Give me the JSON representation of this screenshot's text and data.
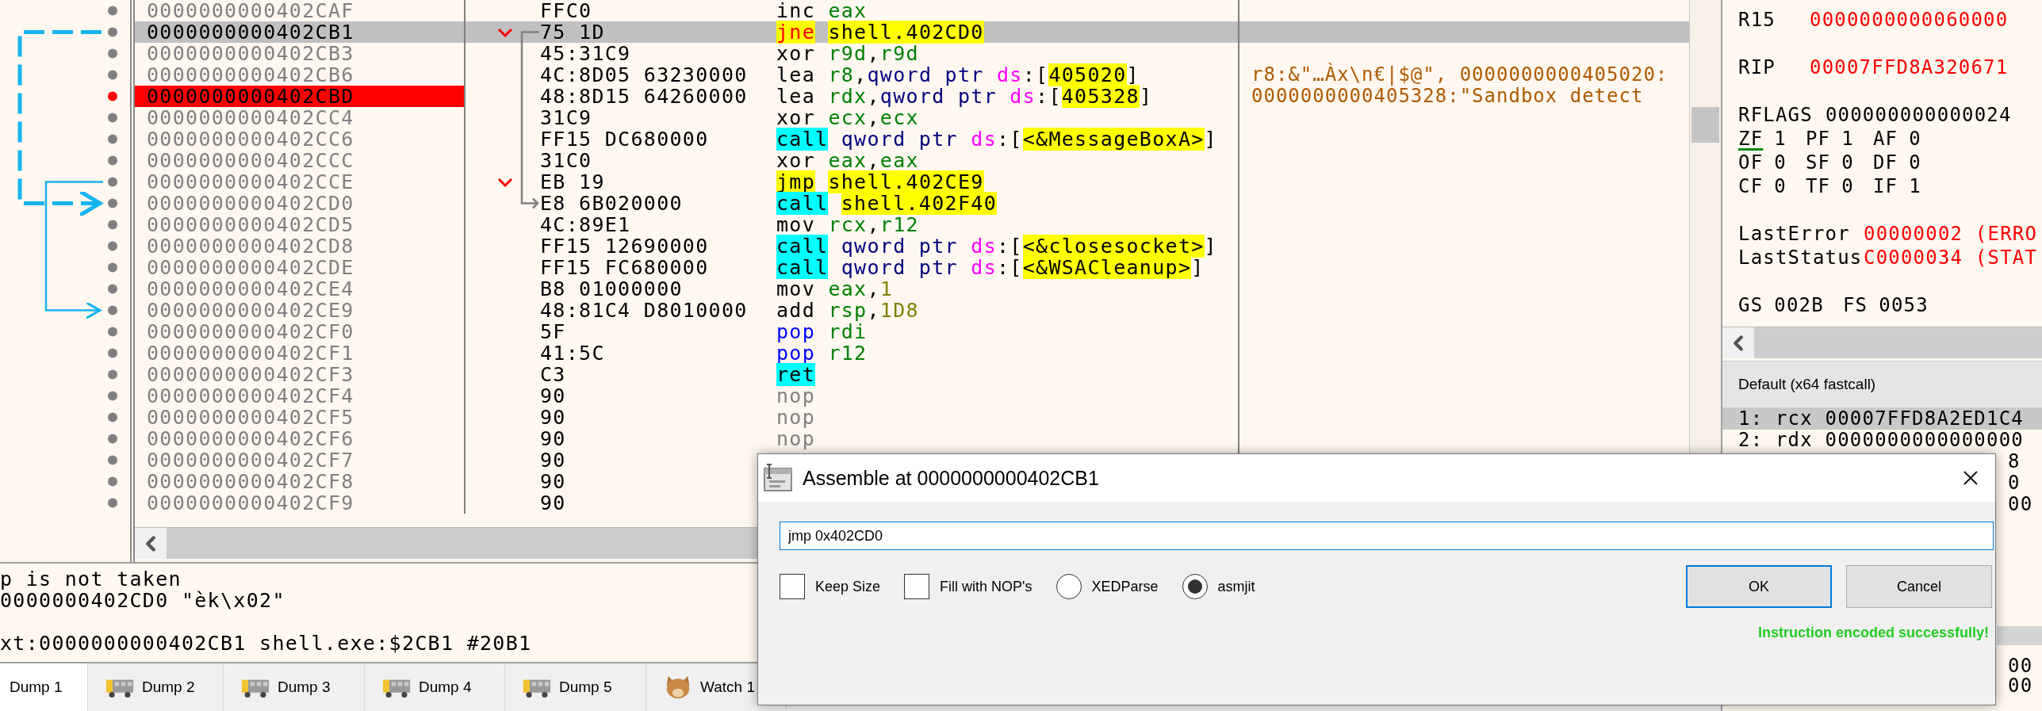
{
  "disassembly": {
    "rows": [
      {
        "address": "0000000000402CAF",
        "bytes": "FFC0",
        "instruction": [
          {
            "text": "inc",
            "kind": "mnemonic"
          },
          {
            "text": " eax",
            "kind": "reg"
          }
        ],
        "selected": false,
        "breakpoint": false,
        "branch": false
      },
      {
        "address": "0000000000402CB1",
        "bytes": "75 1D",
        "instruction": [
          {
            "text": "jne",
            "kind": "cjump"
          },
          {
            "text": " shell.402CD0",
            "kind": "sym"
          }
        ],
        "selected": true,
        "breakpoint": false,
        "branch": true
      },
      {
        "address": "0000000000402CB3",
        "bytes": "45:31C9",
        "instruction": [
          {
            "text": "xor",
            "kind": "mnemonic"
          },
          {
            "text": " r9d",
            "kind": "reg"
          },
          {
            "text": ",",
            "kind": "punct"
          },
          {
            "text": "r9d",
            "kind": "reg"
          }
        ],
        "selected": false,
        "breakpoint": false,
        "branch": false
      },
      {
        "address": "0000000000402CB6",
        "bytes": "4C:8D05 63230000",
        "instruction": [
          {
            "text": "lea",
            "kind": "mnemonic"
          },
          {
            "text": " r8",
            "kind": "reg"
          },
          {
            "text": ",",
            "kind": "punct"
          },
          {
            "text": "qword ptr ",
            "kind": "size"
          },
          {
            "text": "ds",
            "kind": "seg"
          },
          {
            "text": ":[",
            "kind": "punct"
          },
          {
            "text": "405020",
            "kind": "sym"
          },
          {
            "text": "]",
            "kind": "punct"
          }
        ],
        "comment": "r8:&\"…Àx\\n€|$@\", 0000000000405020:",
        "selected": false,
        "breakpoint": false,
        "branch": false
      },
      {
        "address": "0000000000402CBD",
        "bytes": "48:8D15 64260000",
        "instruction": [
          {
            "text": "lea",
            "kind": "mnemonic"
          },
          {
            "text": " rdx",
            "kind": "reg"
          },
          {
            "text": ",",
            "kind": "punct"
          },
          {
            "text": "qword ptr ",
            "kind": "size"
          },
          {
            "text": "ds",
            "kind": "seg"
          },
          {
            "text": ":[",
            "kind": "punct"
          },
          {
            "text": "405328",
            "kind": "sym"
          },
          {
            "text": "]",
            "kind": "punct"
          }
        ],
        "comment": "0000000000405328:\"Sandbox detect",
        "selected": false,
        "breakpoint": true,
        "branch": false
      },
      {
        "address": "0000000000402CC4",
        "bytes": "31C9",
        "instruction": [
          {
            "text": "xor",
            "kind": "mnemonic"
          },
          {
            "text": " ecx",
            "kind": "reg"
          },
          {
            "text": ",",
            "kind": "punct"
          },
          {
            "text": "ecx",
            "kind": "reg"
          }
        ],
        "selected": false,
        "breakpoint": false,
        "branch": false
      },
      {
        "address": "0000000000402CC6",
        "bytes": "FF15 DC680000",
        "instruction": [
          {
            "text": "call",
            "kind": "call"
          },
          {
            "text": " qword ptr ",
            "kind": "size"
          },
          {
            "text": "ds",
            "kind": "seg"
          },
          {
            "text": ":[",
            "kind": "punct"
          },
          {
            "text": "<&MessageBoxA>",
            "kind": "sym"
          },
          {
            "text": "]",
            "kind": "punct"
          }
        ],
        "selected": false,
        "breakpoint": false,
        "branch": false
      },
      {
        "address": "0000000000402CCC",
        "bytes": "31C0",
        "instruction": [
          {
            "text": "xor",
            "kind": "mnemonic"
          },
          {
            "text": " eax",
            "kind": "reg"
          },
          {
            "text": ",",
            "kind": "punct"
          },
          {
            "text": "eax",
            "kind": "reg"
          }
        ],
        "selected": false,
        "breakpoint": false,
        "branch": false
      },
      {
        "address": "0000000000402CCE",
        "bytes": "EB 19",
        "instruction": [
          {
            "text": "jmp",
            "kind": "jump"
          },
          {
            "text": " shell.402CE9",
            "kind": "sym"
          }
        ],
        "selected": false,
        "breakpoint": false,
        "branch": true
      },
      {
        "address": "0000000000402CD0",
        "bytes": "E8 6B020000",
        "instruction": [
          {
            "text": "call",
            "kind": "call"
          },
          {
            "text": " shell.402F40",
            "kind": "sym"
          }
        ],
        "selected": false,
        "breakpoint": false,
        "branch": false
      },
      {
        "address": "0000000000402CD5",
        "bytes": "4C:89E1",
        "instruction": [
          {
            "text": "mov",
            "kind": "mnemonic"
          },
          {
            "text": " rcx",
            "kind": "reg"
          },
          {
            "text": ",",
            "kind": "punct"
          },
          {
            "text": "r12",
            "kind": "reg"
          }
        ],
        "selected": false,
        "breakpoint": false,
        "branch": false
      },
      {
        "address": "0000000000402CD8",
        "bytes": "FF15 12690000",
        "instruction": [
          {
            "text": "call",
            "kind": "call"
          },
          {
            "text": " qword ptr ",
            "kind": "size"
          },
          {
            "text": "ds",
            "kind": "seg"
          },
          {
            "text": ":[",
            "kind": "punct"
          },
          {
            "text": "<&closesocket>",
            "kind": "sym"
          },
          {
            "text": "]",
            "kind": "punct"
          }
        ],
        "selected": false,
        "breakpoint": false,
        "branch": false
      },
      {
        "address": "0000000000402CDE",
        "bytes": "FF15 FC680000",
        "instruction": [
          {
            "text": "call",
            "kind": "call"
          },
          {
            "text": " qword ptr ",
            "kind": "size"
          },
          {
            "text": "ds",
            "kind": "seg"
          },
          {
            "text": ":[",
            "kind": "punct"
          },
          {
            "text": "<&WSACleanup>",
            "kind": "sym"
          },
          {
            "text": "]",
            "kind": "punct"
          }
        ],
        "selected": false,
        "breakpoint": false,
        "branch": false
      },
      {
        "address": "0000000000402CE4",
        "bytes": "B8 01000000",
        "instruction": [
          {
            "text": "mov",
            "kind": "mnemonic"
          },
          {
            "text": " eax",
            "kind": "reg"
          },
          {
            "text": ",",
            "kind": "punct"
          },
          {
            "text": "1",
            "kind": "num"
          }
        ],
        "selected": false,
        "breakpoint": false,
        "branch": false
      },
      {
        "address": "0000000000402CE9",
        "bytes": "48:81C4 D8010000",
        "instruction": [
          {
            "text": "add",
            "kind": "mnemonic"
          },
          {
            "text": " rsp",
            "kind": "reg"
          },
          {
            "text": ",",
            "kind": "punct"
          },
          {
            "text": "1D8",
            "kind": "num"
          }
        ],
        "selected": false,
        "breakpoint": false,
        "branch": false
      },
      {
        "address": "0000000000402CF0",
        "bytes": "5F",
        "instruction": [
          {
            "text": "pop",
            "kind": "stack"
          },
          {
            "text": " rdi",
            "kind": "reg"
          }
        ],
        "selected": false,
        "breakpoint": false,
        "branch": false
      },
      {
        "address": "0000000000402CF1",
        "bytes": "41:5C",
        "instruction": [
          {
            "text": "pop",
            "kind": "stack"
          },
          {
            "text": " r12",
            "kind": "reg"
          }
        ],
        "selected": false,
        "breakpoint": false,
        "branch": false
      },
      {
        "address": "0000000000402CF3",
        "bytes": "C3",
        "instruction": [
          {
            "text": "ret",
            "kind": "ret"
          }
        ],
        "selected": false,
        "breakpoint": false,
        "branch": false
      },
      {
        "address": "0000000000402CF4",
        "bytes": "90",
        "instruction": [
          {
            "text": "nop",
            "kind": "nop"
          }
        ],
        "selected": false,
        "breakpoint": false,
        "branch": false
      },
      {
        "address": "0000000000402CF5",
        "bytes": "90",
        "instruction": [
          {
            "text": "nop",
            "kind": "nop"
          }
        ],
        "selected": false,
        "breakpoint": false,
        "branch": false
      },
      {
        "address": "0000000000402CF6",
        "bytes": "90",
        "instruction": [
          {
            "text": "nop",
            "kind": "nop"
          }
        ],
        "selected": false,
        "breakpoint": false,
        "branch": false
      },
      {
        "address": "0000000000402CF7",
        "bytes": "90",
        "selected": false,
        "breakpoint": false,
        "branch": false
      },
      {
        "address": "0000000000402CF8",
        "bytes": "90",
        "selected": false,
        "breakpoint": false,
        "branch": false
      },
      {
        "address": "0000000000402CF9",
        "bytes": "90",
        "selected": false,
        "breakpoint": false,
        "branch": false
      }
    ]
  },
  "info_lines": [
    {
      "kind": "line",
      "text": "p is not taken"
    },
    {
      "kind": "line",
      "text": "0000000402CD0 \"èk\\x02\""
    },
    {
      "kind": "blank"
    },
    {
      "kind": "line",
      "text": "xt:0000000000402CB1 shell.exe:$2CB1 #20B1"
    }
  ],
  "tabs": [
    {
      "label": "Dump 1",
      "kind": "plain",
      "selected": true
    },
    {
      "label": "Dump 2",
      "kind": "dump",
      "selected": false
    },
    {
      "label": "Dump 3",
      "kind": "dump",
      "selected": false
    },
    {
      "label": "Dump 4",
      "kind": "dump",
      "selected": false
    },
    {
      "label": "Dump 5",
      "kind": "dump",
      "selected": false
    },
    {
      "label": "Watch 1",
      "kind": "watch",
      "selected": false
    }
  ],
  "registers": [
    {
      "kind": "reg",
      "name": "R15",
      "value": "0000000000060000",
      "changed": true
    },
    {
      "kind": "blank"
    },
    {
      "kind": "reg",
      "name": "RIP",
      "value": "00007FFD8A320671",
      "changed": true
    },
    {
      "kind": "blank"
    },
    {
      "kind": "reg",
      "name": "RFLAGS",
      "value": "000000000000024",
      "changed": false
    },
    {
      "kind": "flags",
      "flags": [
        {
          "name": "ZF",
          "value": "1",
          "marked": true
        },
        {
          "name": "PF",
          "value": "1",
          "marked": false
        },
        {
          "name": "AF",
          "value": "0",
          "marked": false
        }
      ]
    },
    {
      "kind": "flags",
      "flags": [
        {
          "name": "OF",
          "value": "0",
          "marked": false
        },
        {
          "name": "SF",
          "value": "0",
          "marked": false
        },
        {
          "name": "DF",
          "value": "0",
          "marked": false
        }
      ]
    },
    {
      "kind": "flags",
      "flags": [
        {
          "name": "CF",
          "value": "0",
          "marked": false
        },
        {
          "name": "TF",
          "value": "0",
          "marked": false
        },
        {
          "name": "IF",
          "value": "1",
          "marked": false
        }
      ]
    },
    {
      "kind": "blank"
    },
    {
      "kind": "error",
      "name": "LastError",
      "value": "00000002 (ERRO",
      "changed": true
    },
    {
      "kind": "error",
      "name": "LastStatus",
      "value": "C0000034 (STAT",
      "changed": true
    },
    {
      "kind": "blank"
    },
    {
      "kind": "flags",
      "flags": [
        {
          "name": "GS",
          "value": "002B",
          "marked": false
        },
        {
          "name": "FS",
          "value": "0053",
          "marked": false
        }
      ]
    }
  ],
  "call_convention": "Default (x64 fastcall)",
  "arguments": [
    {
      "text": "1: rcx 00007FFD8A2ED1C4",
      "kind": "full",
      "selected": true
    },
    {
      "text": "2: rdx 0000000000000000",
      "kind": "full",
      "selected": false
    },
    {
      "text": "8",
      "kind": "partial",
      "selected": false
    },
    {
      "text": "0",
      "kind": "partial",
      "selected": false
    },
    {
      "text": "00",
      "kind": "partial",
      "selected": false
    }
  ],
  "stack_fragments": [
    "00",
    "00"
  ],
  "dialog": {
    "title": "Assemble at 0000000000402CB1",
    "input": {
      "value": "jmp 0x402CD0"
    },
    "options": [
      {
        "kind": "checkbox",
        "label": "Keep Size",
        "checked": false
      },
      {
        "kind": "checkbox",
        "label": "Fill with NOP's",
        "checked": false
      },
      {
        "kind": "radio",
        "label": "XEDParse",
        "selected": false
      },
      {
        "kind": "radio",
        "label": "asmjit",
        "selected": true
      }
    ],
    "buttons": [
      {
        "label": "OK",
        "default": true
      },
      {
        "label": "Cancel",
        "default": false
      }
    ],
    "status": "Instruction encoded successfully!"
  }
}
